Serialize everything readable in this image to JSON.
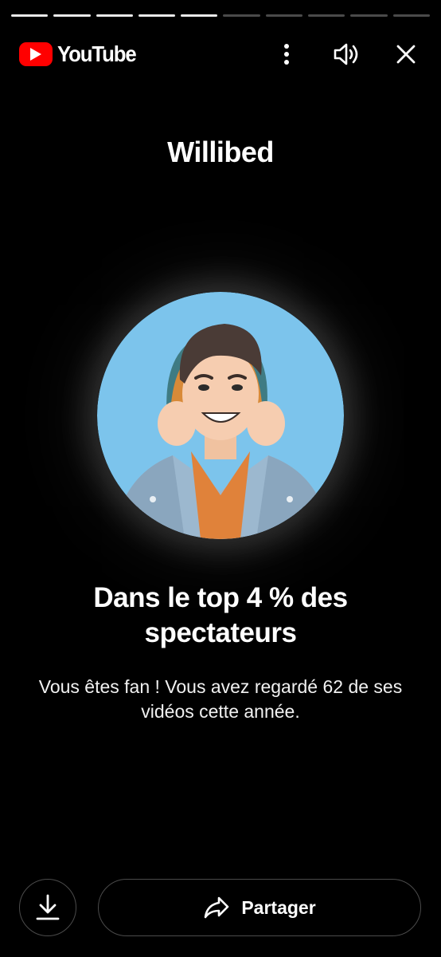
{
  "story": {
    "total_segments": 10,
    "completed_segments": 5
  },
  "header": {
    "brand": "YouTube",
    "icons": {
      "logo": "youtube-play-icon",
      "menu": "more-vertical-icon",
      "sound": "volume-icon",
      "close": "close-icon"
    }
  },
  "card": {
    "channel_name": "Willibed",
    "avatar": "channel-avatar-cartoon",
    "headline": "Dans le top 4 % des spectateurs",
    "description": "Vous êtes fan ! Vous avez regardé 62 de ses vidéos cette année."
  },
  "actions": {
    "download_icon": "download-icon",
    "share_icon": "share-arrow-icon",
    "share_label": "Partager"
  },
  "colors": {
    "background": "#000000",
    "brand_red": "#ff0000",
    "avatar_bg": "#7cc4ec",
    "progress_filled": "#e9e9e9",
    "progress_empty": "#4a4a4a",
    "button_border": "#4b4b4b"
  }
}
